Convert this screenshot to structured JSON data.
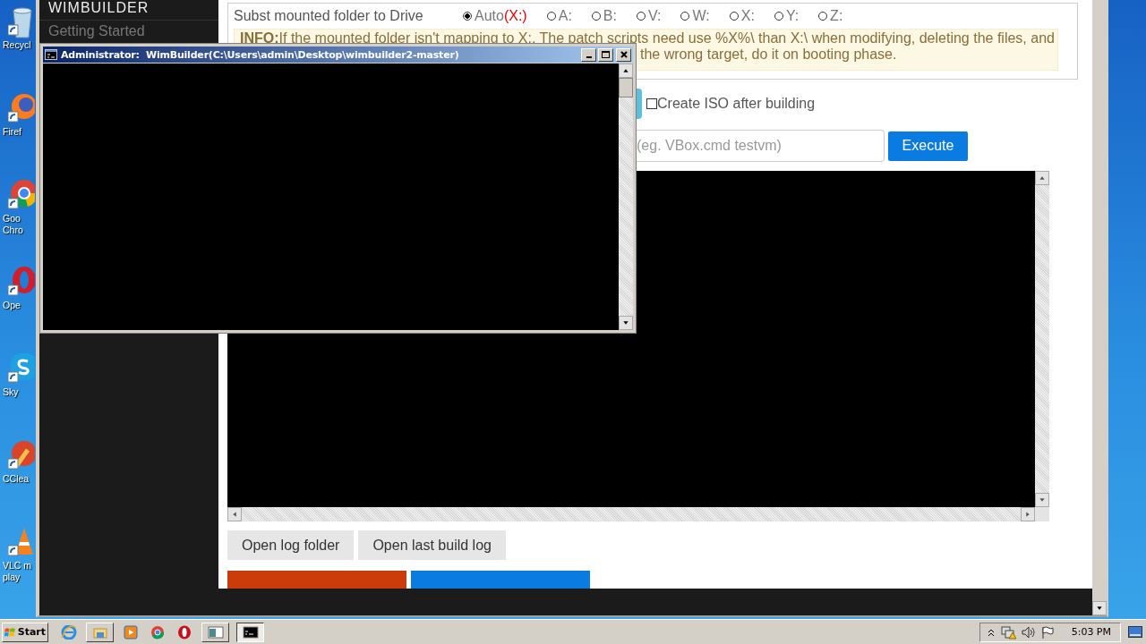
{
  "desktop_icons": [
    {
      "kind": "recycle-bin",
      "lines": [
        "Recycl"
      ]
    },
    {
      "kind": "firefox",
      "lines": [
        "Firef"
      ]
    },
    {
      "kind": "chrome",
      "lines": [
        "Goo",
        "Chro"
      ]
    },
    {
      "kind": "opera",
      "lines": [
        "Ope"
      ]
    },
    {
      "kind": "skype",
      "lines": [
        "Sky"
      ]
    },
    {
      "kind": "ccleaner",
      "lines": [
        "CClea"
      ]
    },
    {
      "kind": "vlc",
      "lines": [
        "VLC m",
        "play"
      ]
    }
  ],
  "app": {
    "sidebar": {
      "title": "WIMBUILDER",
      "items": [
        {
          "label": "Getting Started",
          "selected": false
        }
      ]
    },
    "subst": {
      "label": "Subst mounted folder to Drive",
      "radios": [
        {
          "label": "Auto",
          "note": "(X:)",
          "selected": true
        },
        {
          "label": "A:",
          "selected": false
        },
        {
          "label": "B:",
          "selected": false
        },
        {
          "label": "V:",
          "selected": false
        },
        {
          "label": "W:",
          "selected": false
        },
        {
          "label": "X:",
          "selected": false
        },
        {
          "label": "Y:",
          "selected": false
        },
        {
          "label": "Z:",
          "selected": false
        }
      ],
      "info_lines": [
        "**INFO:**If the mounted folder isn't mapping to X:, The patch scripts need use %X%\\ than X:\\ when modifying, deleting the files, and",
        "the wrong target, do it on booting phase."
      ]
    },
    "iso_checkbox": {
      "label": "Create ISO after building",
      "checked": false
    },
    "command": {
      "placeholder": "(eg. VBox.cmd testvm)",
      "button": "Execute"
    },
    "log_buttons": [
      "Open log folder",
      "Open last build log"
    ]
  },
  "cmd_window": {
    "title": "Administrator:  WimBuilder(C:\\Users\\admin\\Desktop\\wimbuilder2-master)"
  },
  "taskbar": {
    "start": "Start",
    "apps": [
      {
        "kind": "ie",
        "framed": false,
        "selected": false
      },
      {
        "kind": "explorer",
        "framed": true,
        "selected": false
      },
      {
        "kind": "media",
        "framed": false,
        "selected": false
      },
      {
        "kind": "chrome",
        "framed": false,
        "selected": false
      },
      {
        "kind": "opera",
        "framed": false,
        "selected": false
      },
      {
        "kind": "window",
        "framed": true,
        "selected": false
      },
      {
        "kind": "cmd",
        "framed": true,
        "selected": true
      }
    ],
    "clock": "5:03 PM"
  }
}
